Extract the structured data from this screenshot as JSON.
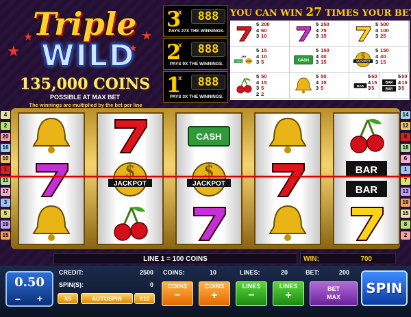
{
  "logo": {
    "line1": "Triple",
    "line2": "WILD",
    "coins": "135,000 COINS",
    "possible": "POSSIBLE AT MAX BET",
    "multiplied": "The winnings are multiplied by the bet per line"
  },
  "multipliers": [
    {
      "num": "3",
      "x": "x",
      "sym": "888",
      "pays": "PAYS 27X THE WINNINGS."
    },
    {
      "num": "2",
      "x": "x",
      "sym": "888",
      "pays": "PAYS 9X THE WINNINGS."
    },
    {
      "num": "1",
      "x": "x",
      "sym": "888",
      "pays": "PAYS 3X THE WINNINGS."
    }
  ],
  "paytable": {
    "title_pre": "YOU CAN WIN",
    "title_num": "27",
    "title_post": "TIMES YOUR BET",
    "rows": [
      [
        {
          "sym": "seven-red",
          "k": [
            "5",
            "4",
            "3"
          ],
          "v": [
            "200",
            "60",
            "10"
          ]
        },
        {
          "sym": "seven-purple",
          "k": [
            "5",
            "4",
            "3"
          ],
          "v": [
            "250",
            "75",
            "15"
          ]
        },
        {
          "sym": "seven-yellow",
          "k": [
            "5",
            "4",
            "3"
          ],
          "v": [
            "500",
            "100",
            "25"
          ]
        }
      ],
      [
        {
          "sym": "any-cash-jackpot",
          "k": [
            "5",
            "4",
            "3"
          ],
          "v": [
            "15",
            "10",
            "5"
          ]
        },
        {
          "sym": "cash",
          "k": [
            "5",
            "4",
            "3"
          ],
          "v": [
            "150",
            "40",
            "15"
          ]
        },
        {
          "sym": "jackpot",
          "k": [
            "5",
            "4",
            "3"
          ],
          "v": [
            "150",
            "40",
            "15"
          ]
        }
      ],
      [
        {
          "sym": "cherry",
          "k": [
            "5",
            "4",
            "3",
            "2"
          ],
          "v": [
            "50",
            "15",
            "5",
            "2"
          ]
        },
        {
          "sym": "bell",
          "k": [
            "5",
            "4",
            "3"
          ],
          "v": [
            "50",
            "15",
            "5"
          ]
        },
        {
          "sym": "bar",
          "k": [
            "5",
            "4",
            "3"
          ],
          "v": [
            "50",
            "15",
            "5"
          ]
        }
      ],
      [
        {
          "sym": "bar-bar",
          "k": [
            "5",
            "4",
            "3"
          ],
          "v": [
            "50",
            "15",
            "5"
          ]
        }
      ]
    ]
  },
  "lines_left": [
    "4",
    "2",
    "20",
    "16",
    "10",
    "1",
    "11",
    "17",
    "3",
    "5",
    "19",
    "15"
  ],
  "lines_right": [
    "14",
    "12",
    "9",
    "18",
    "6",
    "1",
    "7",
    "13",
    "19",
    "15",
    "8",
    "2"
  ],
  "reels": [
    [
      "bell",
      "seven-purple",
      "bell"
    ],
    [
      "seven-red",
      "jackpot",
      "cherry"
    ],
    [
      "cash",
      "jackpot",
      "seven-purple"
    ],
    [
      "bell",
      "seven-red",
      "bell"
    ],
    [
      "cherry",
      "bar-bar",
      "seven-yellow"
    ]
  ],
  "symbol_text": {
    "cash": "CASH",
    "jackpot": "JACKPOT",
    "bar": "BAR",
    "any": "ANY"
  },
  "status": {
    "line_info": "LINE 1 = 100 COINS",
    "win_label": "WIN:",
    "win_value": "700"
  },
  "bet": {
    "value": "0.50",
    "minus": "–",
    "plus": "+"
  },
  "credit": {
    "label": "CREDIT:",
    "value": "2500"
  },
  "spins": {
    "label": "SPIN(S):",
    "value": "0"
  },
  "coins": {
    "label": "COINS:",
    "value": "10"
  },
  "lines": {
    "label": "LINES:",
    "value": "20"
  },
  "betval": {
    "label": "BET:",
    "value": "200"
  },
  "buttons": {
    "x5": "X5",
    "autospin": "AUTOSPIN",
    "x10": "X10",
    "coins_minus": "COINS",
    "coins_plus": "COINS",
    "lines_minus": "LINES",
    "lines_plus": "LINES",
    "betmax1": "BET",
    "betmax2": "MAX",
    "spin": "SPIN",
    "minus": "−",
    "plus": "+"
  },
  "colors": {
    "accent": "#ffd000",
    "payline": "#d60000"
  }
}
